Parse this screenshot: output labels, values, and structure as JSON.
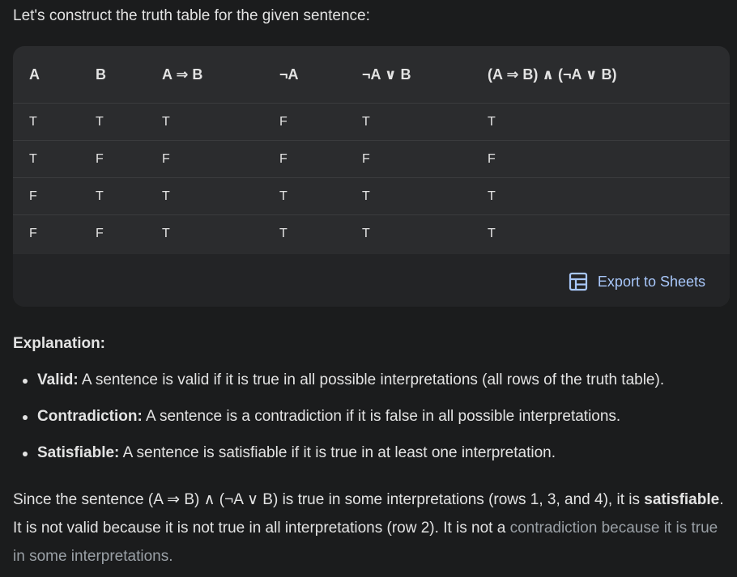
{
  "intro": "Let's construct the truth table for the given sentence:",
  "table": {
    "headers": [
      "A",
      "B",
      "A ⇒ B",
      "¬A",
      "¬A ∨ B",
      "(A ⇒ B) ∧ (¬A ∨ B)"
    ],
    "rows": [
      [
        "T",
        "T",
        "T",
        "F",
        "T",
        "T"
      ],
      [
        "T",
        "F",
        "F",
        "F",
        "F",
        "F"
      ],
      [
        "F",
        "T",
        "T",
        "T",
        "T",
        "T"
      ],
      [
        "F",
        "F",
        "T",
        "T",
        "T",
        "T"
      ]
    ]
  },
  "export": {
    "label": "Export to Sheets",
    "icon": "table-grid-icon",
    "color": "#a8c7fa"
  },
  "explanation": {
    "title": "Explanation:",
    "items": [
      {
        "term": "Valid:",
        "text": " A sentence is valid if it is true in all possible interpretations (all rows of the truth table)."
      },
      {
        "term": "Contradiction:",
        "text": " A sentence is a contradiction if it is false in all possible interpretations."
      },
      {
        "term": "Satisfiable:",
        "text": " A sentence is satisfiable if it is true in at least one interpretation."
      }
    ]
  },
  "summary": {
    "part1": "Since the sentence (A ⇒ B) ∧ (¬A ∨ B) is true in some interpretations (rows 1, 3, and 4), it is ",
    "bold": "satisfiable",
    "part2": ". It is not valid because it is not true in all interpretations (row 2). It is not a ",
    "faded": "contradiction because it is true in some interpretations."
  }
}
